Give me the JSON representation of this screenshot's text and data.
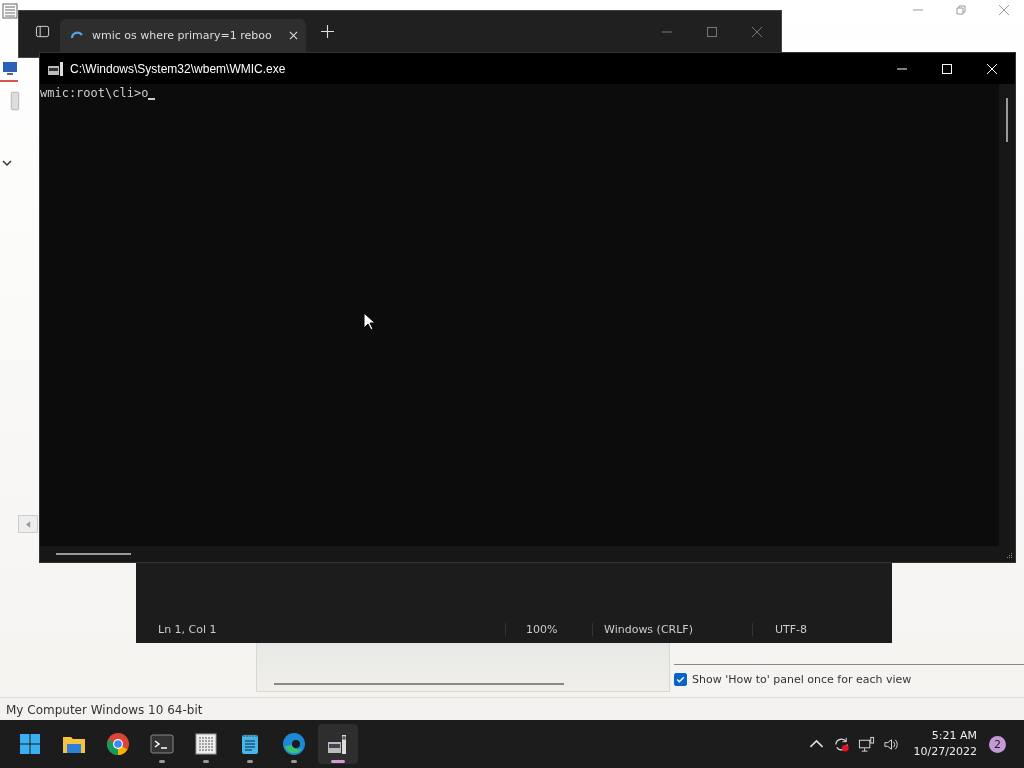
{
  "background_app": {
    "status_bar": "My Computer Windows 10 64-bit",
    "option": {
      "label": "Show 'How to' panel once for each view",
      "checked": true
    }
  },
  "terminal_window": {
    "tabs": [
      {
        "title": "wmic os where primary=1 reboo",
        "selected": true
      }
    ]
  },
  "notepad_status": [
    "Ln 1, Col 1",
    "100%",
    "Windows (CRLF)",
    "UTF-8"
  ],
  "console": {
    "title": "C:\\Windows\\System32\\wbem\\WMIC.exe",
    "prompt": "wmic:root\\cli>",
    "input": "o"
  },
  "taskbar": {
    "apps": [
      {
        "kind": "start",
        "running": false,
        "selected": false
      },
      {
        "kind": "folder",
        "running": false,
        "selected": false
      },
      {
        "kind": "chrome",
        "running": false,
        "selected": false
      },
      {
        "kind": "terminal",
        "running": true,
        "selected": false
      },
      {
        "kind": "hex",
        "running": true,
        "selected": false
      },
      {
        "kind": "notepad",
        "running": true,
        "selected": false
      },
      {
        "kind": "edge",
        "running": true,
        "selected": false
      },
      {
        "kind": "wmic",
        "running": true,
        "selected": true
      }
    ],
    "time": "5:21 AM",
    "date": "10/27/2022",
    "notification_count": "2"
  }
}
